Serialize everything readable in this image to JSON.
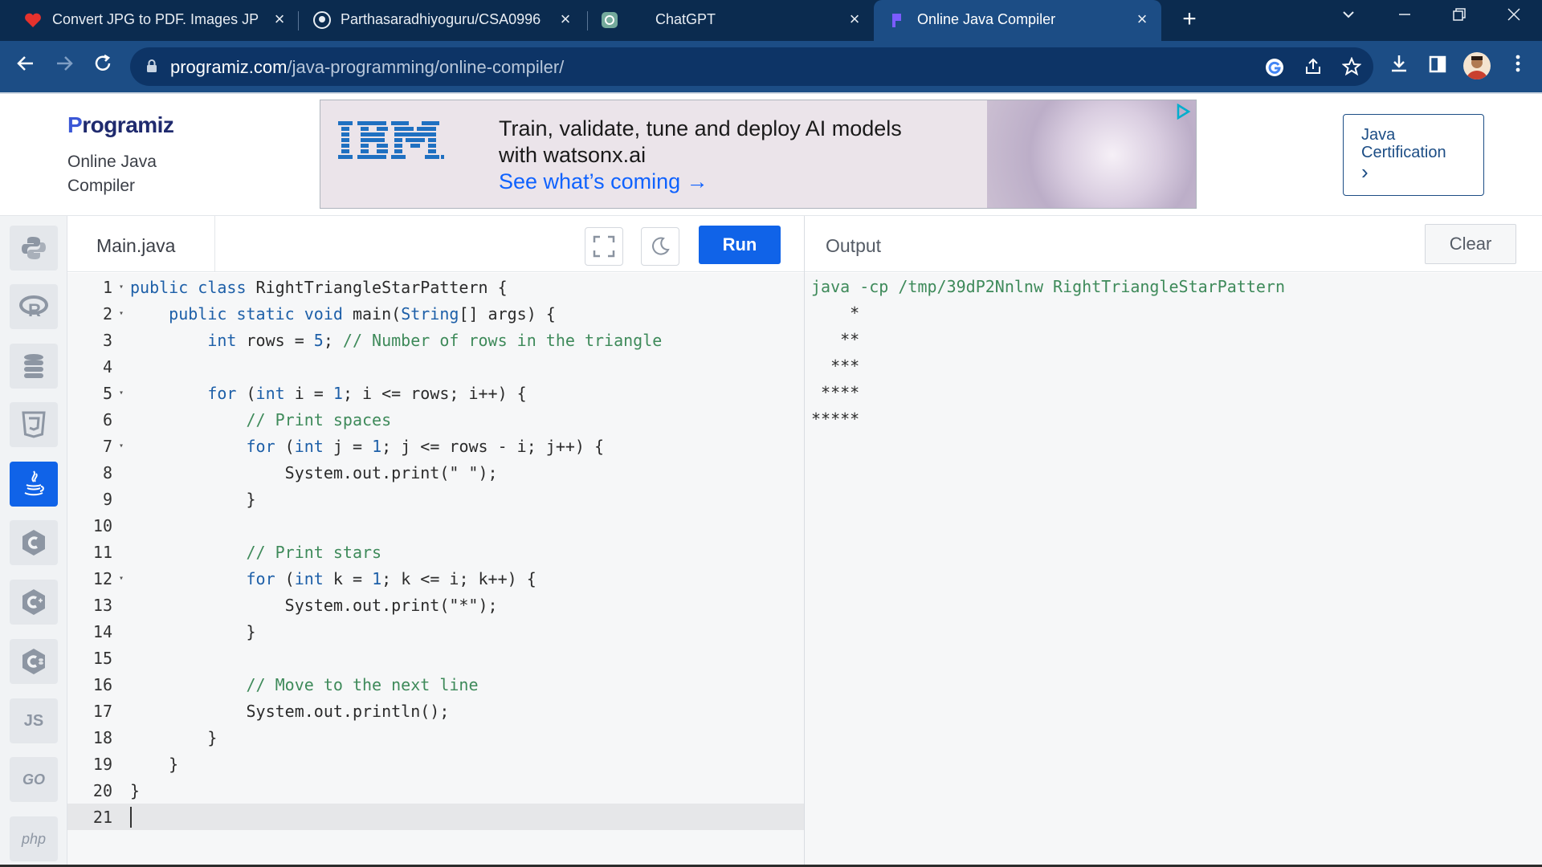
{
  "browser": {
    "tabs": [
      {
        "title": "Convert JPG to PDF. Images JPG",
        "icon": "ilovepdf-heart-icon",
        "active": false
      },
      {
        "title": "Parthasaradhiyoguru/CSA0996--",
        "icon": "github-icon",
        "active": false
      },
      {
        "title": "ChatGPT",
        "icon": "chatgpt-icon",
        "active": false
      },
      {
        "title": "Online Java Compiler",
        "icon": "programiz-icon",
        "active": true
      }
    ],
    "new_tab_symbol": "+",
    "address": {
      "host": "programiz.com",
      "path": "/java-programming/online-compiler/"
    }
  },
  "site": {
    "logo_initial": "P",
    "logo_rest": "rogramiz",
    "subtitle": "Online Java Compiler",
    "certification_label": "Java Certification",
    "certification_arrow": "›"
  },
  "ad": {
    "brand": "IBM",
    "line1": "Train, validate, tune and deploy AI models",
    "line2": "with watsonx.ai",
    "cta": "See what’s coming →"
  },
  "sidebar": {
    "languages": [
      {
        "name": "python",
        "label": "",
        "active": false
      },
      {
        "name": "r",
        "label": "R",
        "active": false
      },
      {
        "name": "sql",
        "label": "",
        "active": false
      },
      {
        "name": "html",
        "label": "5",
        "active": false
      },
      {
        "name": "java",
        "label": "",
        "active": true
      },
      {
        "name": "c",
        "label": "C",
        "active": false
      },
      {
        "name": "cpp",
        "label": "C",
        "active": false
      },
      {
        "name": "csharp",
        "label": "C",
        "active": false
      },
      {
        "name": "javascript",
        "label": "JS",
        "active": false
      },
      {
        "name": "go",
        "label": "GO",
        "active": false
      },
      {
        "name": "php",
        "label": "php",
        "active": false
      }
    ]
  },
  "editor": {
    "filename": "Main.java",
    "run_label": "Run",
    "lines": [
      {
        "n": "1",
        "fold": true,
        "html": "<span class=\"kw\">public</span> <span class=\"kw\">class</span> RightTriangleStarPattern {"
      },
      {
        "n": "2",
        "fold": true,
        "html": "    <span class=\"kw\">public</span> <span class=\"kw\">static</span> <span class=\"kw\">void</span> main(<span class=\"ty\">String</span>[] args) {"
      },
      {
        "n": "3",
        "fold": false,
        "html": "        <span class=\"kw\">int</span> rows = <span class=\"num\">5</span>; <span class=\"cm\">// Number of rows in the triangle</span>"
      },
      {
        "n": "4",
        "fold": false,
        "html": ""
      },
      {
        "n": "5",
        "fold": true,
        "html": "        <span class=\"kw\">for</span> (<span class=\"kw\">int</span> i = <span class=\"num\">1</span>; i &lt;= rows; i++) {"
      },
      {
        "n": "6",
        "fold": false,
        "html": "            <span class=\"cm\">// Print spaces</span>"
      },
      {
        "n": "7",
        "fold": true,
        "html": "            <span class=\"kw\">for</span> (<span class=\"kw\">int</span> j = <span class=\"num\">1</span>; j &lt;= rows - i; j++) {"
      },
      {
        "n": "8",
        "fold": false,
        "html": "                System.out.print(\" \");"
      },
      {
        "n": "9",
        "fold": false,
        "html": "            }"
      },
      {
        "n": "10",
        "fold": false,
        "html": ""
      },
      {
        "n": "11",
        "fold": false,
        "html": "            <span class=\"cm\">// Print stars</span>"
      },
      {
        "n": "12",
        "fold": true,
        "html": "            <span class=\"kw\">for</span> (<span class=\"kw\">int</span> k = <span class=\"num\">1</span>; k &lt;= i; k++) {"
      },
      {
        "n": "13",
        "fold": false,
        "html": "                System.out.print(\"*\");"
      },
      {
        "n": "14",
        "fold": false,
        "html": "            }"
      },
      {
        "n": "15",
        "fold": false,
        "html": ""
      },
      {
        "n": "16",
        "fold": false,
        "html": "            <span class=\"cm\">// Move to the next line</span>"
      },
      {
        "n": "17",
        "fold": false,
        "html": "            System.out.println();"
      },
      {
        "n": "18",
        "fold": false,
        "html": "        }"
      },
      {
        "n": "19",
        "fold": false,
        "html": "    }"
      },
      {
        "n": "20",
        "fold": false,
        "html": "}"
      },
      {
        "n": "21",
        "fold": false,
        "html": "",
        "current": true
      }
    ]
  },
  "output": {
    "title": "Output",
    "clear_label": "Clear",
    "command": "java -cp /tmp/39dP2Nnlnw RightTriangleStarPattern",
    "lines": [
      "    *",
      "   **",
      "  ***",
      " ****",
      "*****"
    ]
  },
  "colors": {
    "accent": "#1063e8",
    "browser_frame": "#1c4d85",
    "tabstrip": "#0b2b4f",
    "comment": "#3e8a5a",
    "keyword": "#1d5fa8"
  }
}
